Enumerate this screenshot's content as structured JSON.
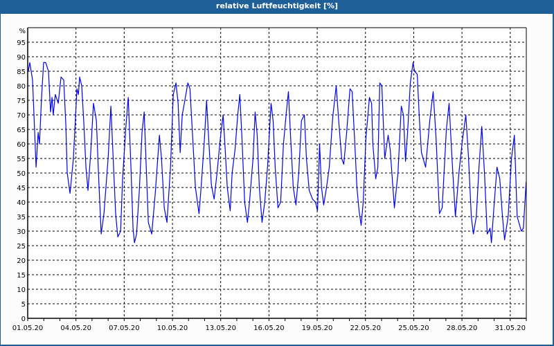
{
  "window": {
    "title": "relative Luftfeuchtigkeit [%]"
  },
  "chart_data": {
    "type": "line",
    "title": "relative Luftfeuchtigkeit [%]",
    "xlabel": "",
    "ylabel": "%",
    "x_unit": "days since 01.05.20 00:00",
    "xlim": [
      0,
      31
    ],
    "ylim": [
      0,
      100
    ],
    "y_ticks": [
      0,
      5,
      10,
      15,
      20,
      25,
      30,
      35,
      40,
      45,
      50,
      55,
      60,
      65,
      70,
      75,
      80,
      85,
      90,
      95
    ],
    "x_ticks": [
      {
        "day": 0,
        "label": "01.05.20"
      },
      {
        "day": 3,
        "label": "04.05.20"
      },
      {
        "day": 6,
        "label": "07.05.20"
      },
      {
        "day": 9,
        "label": "10.05.20"
      },
      {
        "day": 12,
        "label": "13.05.20"
      },
      {
        "day": 15,
        "label": "16.05.20"
      },
      {
        "day": 18,
        "label": "19.05.20"
      },
      {
        "day": 21,
        "label": "22.05.20"
      },
      {
        "day": 24,
        "label": "25.05.20"
      },
      {
        "day": 27,
        "label": "28.05.20"
      },
      {
        "day": 30,
        "label": "31.05.20"
      }
    ],
    "grid": true,
    "series": [
      {
        "name": "relative Luftfeuchtigkeit",
        "color": "#0000ee",
        "points": [
          [
            0.04,
            85
          ],
          [
            0.13,
            88
          ],
          [
            0.3,
            82
          ],
          [
            0.52,
            52
          ],
          [
            0.65,
            64
          ],
          [
            0.73,
            60
          ],
          [
            0.86,
            76
          ],
          [
            0.99,
            88
          ],
          [
            1.12,
            88
          ],
          [
            1.29,
            85
          ],
          [
            1.42,
            71
          ],
          [
            1.51,
            76
          ],
          [
            1.59,
            70
          ],
          [
            1.72,
            77
          ],
          [
            1.9,
            74
          ],
          [
            2.07,
            83
          ],
          [
            2.24,
            82
          ],
          [
            2.37,
            67
          ],
          [
            2.46,
            50
          ],
          [
            2.63,
            43
          ],
          [
            2.84,
            55
          ],
          [
            3.06,
            79
          ],
          [
            3.15,
            77
          ],
          [
            3.23,
            83
          ],
          [
            3.36,
            80
          ],
          [
            3.49,
            67
          ],
          [
            3.62,
            52
          ],
          [
            3.75,
            44
          ],
          [
            3.92,
            57
          ],
          [
            4.09,
            74
          ],
          [
            4.27,
            68
          ],
          [
            4.4,
            50
          ],
          [
            4.57,
            29
          ],
          [
            4.74,
            36
          ],
          [
            5.0,
            55
          ],
          [
            5.17,
            73
          ],
          [
            5.34,
            52
          ],
          [
            5.47,
            36
          ],
          [
            5.6,
            28
          ],
          [
            5.78,
            30
          ],
          [
            5.9,
            48
          ],
          [
            6.12,
            67
          ],
          [
            6.25,
            76
          ],
          [
            6.42,
            52
          ],
          [
            6.55,
            31
          ],
          [
            6.64,
            26
          ],
          [
            6.77,
            29
          ],
          [
            6.94,
            44
          ],
          [
            7.11,
            64
          ],
          [
            7.24,
            71
          ],
          [
            7.37,
            52
          ],
          [
            7.5,
            33
          ],
          [
            7.71,
            29
          ],
          [
            7.93,
            43
          ],
          [
            8.19,
            63
          ],
          [
            8.32,
            55
          ],
          [
            8.49,
            38
          ],
          [
            8.66,
            33
          ],
          [
            8.88,
            52
          ],
          [
            9.05,
            77
          ],
          [
            9.22,
            81
          ],
          [
            9.35,
            74
          ],
          [
            9.48,
            57
          ],
          [
            9.61,
            70
          ],
          [
            9.74,
            74
          ],
          [
            9.96,
            81
          ],
          [
            10.09,
            79
          ],
          [
            10.26,
            62
          ],
          [
            10.43,
            45
          ],
          [
            10.65,
            36
          ],
          [
            10.78,
            45
          ],
          [
            10.99,
            62
          ],
          [
            11.12,
            75
          ],
          [
            11.25,
            62
          ],
          [
            11.42,
            46
          ],
          [
            11.59,
            41
          ],
          [
            11.77,
            50
          ],
          [
            11.98,
            62
          ],
          [
            12.15,
            70
          ],
          [
            12.28,
            58
          ],
          [
            12.41,
            45
          ],
          [
            12.59,
            37
          ],
          [
            12.71,
            50
          ],
          [
            12.89,
            58
          ],
          [
            13.06,
            70
          ],
          [
            13.19,
            77
          ],
          [
            13.32,
            62
          ],
          [
            13.49,
            40
          ],
          [
            13.66,
            33
          ],
          [
            13.79,
            40
          ],
          [
            14.01,
            55
          ],
          [
            14.14,
            71
          ],
          [
            14.27,
            63
          ],
          [
            14.4,
            45
          ],
          [
            14.57,
            33
          ],
          [
            14.74,
            40
          ],
          [
            14.91,
            52
          ],
          [
            15.13,
            74
          ],
          [
            15.26,
            68
          ],
          [
            15.39,
            52
          ],
          [
            15.56,
            38
          ],
          [
            15.73,
            40
          ],
          [
            15.9,
            60
          ],
          [
            16.08,
            71
          ],
          [
            16.21,
            78
          ],
          [
            16.33,
            64
          ],
          [
            16.51,
            45
          ],
          [
            16.68,
            39
          ],
          [
            16.85,
            50
          ],
          [
            17.02,
            68
          ],
          [
            17.2,
            70
          ],
          [
            17.33,
            55
          ],
          [
            17.5,
            44
          ],
          [
            17.71,
            41
          ],
          [
            17.89,
            40
          ],
          [
            18.02,
            37
          ],
          [
            18.15,
            60
          ],
          [
            18.27,
            45
          ],
          [
            18.4,
            39
          ],
          [
            18.58,
            45
          ],
          [
            18.75,
            52
          ],
          [
            18.96,
            69
          ],
          [
            19.18,
            80
          ],
          [
            19.35,
            67
          ],
          [
            19.52,
            55
          ],
          [
            19.65,
            53
          ],
          [
            19.83,
            64
          ],
          [
            20.04,
            79
          ],
          [
            20.17,
            78
          ],
          [
            20.34,
            60
          ],
          [
            20.47,
            45
          ],
          [
            20.6,
            37
          ],
          [
            20.73,
            32
          ],
          [
            20.86,
            40
          ],
          [
            21.03,
            62
          ],
          [
            21.25,
            76
          ],
          [
            21.38,
            74
          ],
          [
            21.46,
            60
          ],
          [
            21.64,
            48
          ],
          [
            21.77,
            52
          ],
          [
            21.89,
            81
          ],
          [
            22.02,
            80
          ],
          [
            22.2,
            55
          ],
          [
            22.41,
            63
          ],
          [
            22.54,
            58
          ],
          [
            22.8,
            38
          ],
          [
            23.02,
            50
          ],
          [
            23.23,
            73
          ],
          [
            23.36,
            70
          ],
          [
            23.49,
            54
          ],
          [
            23.62,
            64
          ],
          [
            23.79,
            81
          ],
          [
            23.96,
            88
          ],
          [
            24.05,
            85
          ],
          [
            24.22,
            84
          ],
          [
            24.35,
            69
          ],
          [
            24.48,
            57
          ],
          [
            24.74,
            52
          ],
          [
            25.0,
            68
          ],
          [
            25.21,
            78
          ],
          [
            25.39,
            62
          ],
          [
            25.6,
            36
          ],
          [
            25.77,
            38
          ],
          [
            26.03,
            65
          ],
          [
            26.2,
            74
          ],
          [
            26.38,
            55
          ],
          [
            26.59,
            35
          ],
          [
            26.81,
            50
          ],
          [
            27.02,
            61
          ],
          [
            27.24,
            70
          ],
          [
            27.41,
            55
          ],
          [
            27.58,
            35
          ],
          [
            27.71,
            29
          ],
          [
            27.89,
            35
          ],
          [
            28.06,
            52
          ],
          [
            28.23,
            66
          ],
          [
            28.4,
            50
          ],
          [
            28.57,
            29
          ],
          [
            28.75,
            31
          ],
          [
            28.83,
            26
          ],
          [
            29.01,
            40
          ],
          [
            29.18,
            52
          ],
          [
            29.35,
            48
          ],
          [
            29.52,
            35
          ],
          [
            29.65,
            27
          ],
          [
            29.87,
            35
          ],
          [
            30.08,
            55
          ],
          [
            30.26,
            63
          ],
          [
            30.43,
            35
          ],
          [
            30.69,
            30
          ],
          [
            30.82,
            31
          ],
          [
            30.99,
            47
          ]
        ]
      }
    ]
  }
}
